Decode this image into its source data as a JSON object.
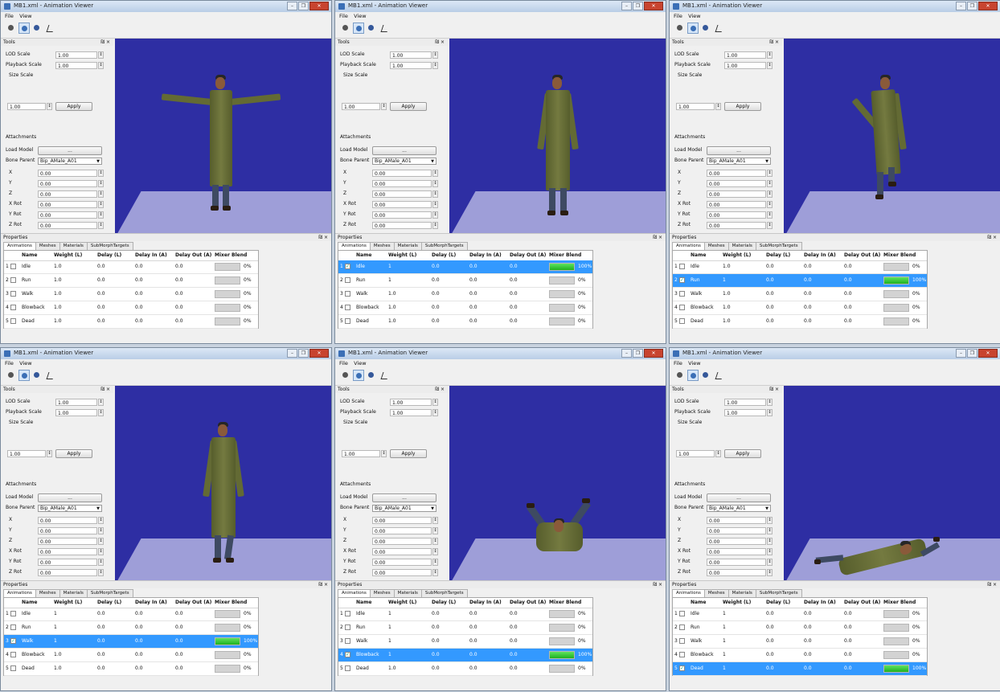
{
  "window": {
    "title": "MB1.xml - Animation Viewer",
    "menu": [
      "File",
      "View"
    ],
    "controls": [
      "–",
      "❐",
      "✕"
    ]
  },
  "tools": {
    "header": "Tools",
    "header_controls": "₪ ×",
    "lod_scale_label": "LOD Scale",
    "lod_scale_value": "1.00",
    "playback_scale_label": "Playback Scale",
    "playback_scale_value": "1.00",
    "size_scale_label": "Size Scale",
    "size_scale_value": "1.00",
    "apply_label": "Apply",
    "attachments_label": "Attachments",
    "load_model_label": "Load Model",
    "load_model_button": "...",
    "bone_parent_label": "Bone Parent",
    "bone_parent_value": "Bip_AMale_A01",
    "coords": [
      {
        "label": "X",
        "value": "0.00"
      },
      {
        "label": "Y",
        "value": "0.00"
      },
      {
        "label": "Z",
        "value": "0.00"
      },
      {
        "label": "X Rot",
        "value": "0.00"
      },
      {
        "label": "Y Rot",
        "value": "0.00"
      },
      {
        "label": "Z Rot",
        "value": "0.00"
      }
    ]
  },
  "properties": {
    "header": "Properties",
    "header_controls": "₪ ×",
    "tabs": [
      "Animations",
      "Meshes",
      "Materials",
      "SubMorphTargets"
    ],
    "columns": [
      "Name",
      "Weight (L)",
      "Delay (L)",
      "Delay In (A)",
      "Delay Out (A)",
      "Mixer Blend"
    ]
  },
  "windows": [
    {
      "pose": "tpose",
      "selected": -1,
      "rows": [
        {
          "num": "1",
          "name": "Idle",
          "weight": "1.0",
          "delay": "0.0",
          "delay_in": "0.0",
          "delay_out": "0.0",
          "blend": "0%",
          "blend_fraction": 0,
          "checked": false
        },
        {
          "num": "2",
          "name": "Run",
          "weight": "1.0",
          "delay": "0.0",
          "delay_in": "0.0",
          "delay_out": "0.0",
          "blend": "0%",
          "blend_fraction": 0,
          "checked": false
        },
        {
          "num": "3",
          "name": "Walk",
          "weight": "1.0",
          "delay": "0.0",
          "delay_in": "0.0",
          "delay_out": "0.0",
          "blend": "0%",
          "blend_fraction": 0,
          "checked": false
        },
        {
          "num": "4",
          "name": "Blowback",
          "weight": "1.0",
          "delay": "0.0",
          "delay_in": "0.0",
          "delay_out": "0.0",
          "blend": "0%",
          "blend_fraction": 0,
          "checked": false
        },
        {
          "num": "5",
          "name": "Dead",
          "weight": "1.0",
          "delay": "0.0",
          "delay_in": "0.0",
          "delay_out": "0.0",
          "blend": "0%",
          "blend_fraction": 0,
          "checked": false
        }
      ]
    },
    {
      "pose": "idle",
      "selected": 0,
      "rows": [
        {
          "num": "1",
          "name": "Idle",
          "weight": "1",
          "delay": "0.0",
          "delay_in": "0.0",
          "delay_out": "0.0",
          "blend": "100%",
          "blend_fraction": 1,
          "checked": true
        },
        {
          "num": "2",
          "name": "Run",
          "weight": "1",
          "delay": "0.0",
          "delay_in": "0.0",
          "delay_out": "0.0",
          "blend": "0%",
          "blend_fraction": 0,
          "checked": false
        },
        {
          "num": "3",
          "name": "Walk",
          "weight": "1.0",
          "delay": "0.0",
          "delay_in": "0.0",
          "delay_out": "0.0",
          "blend": "0%",
          "blend_fraction": 0,
          "checked": false
        },
        {
          "num": "4",
          "name": "Blowback",
          "weight": "1.0",
          "delay": "0.0",
          "delay_in": "0.0",
          "delay_out": "0.0",
          "blend": "0%",
          "blend_fraction": 0,
          "checked": false
        },
        {
          "num": "5",
          "name": "Dead",
          "weight": "1.0",
          "delay": "0.0",
          "delay_in": "0.0",
          "delay_out": "0.0",
          "blend": "0%",
          "blend_fraction": 0,
          "checked": false
        }
      ]
    },
    {
      "pose": "run",
      "selected": 1,
      "rows": [
        {
          "num": "1",
          "name": "Idle",
          "weight": "1.0",
          "delay": "0.0",
          "delay_in": "0.0",
          "delay_out": "0.0",
          "blend": "0%",
          "blend_fraction": 0,
          "checked": false
        },
        {
          "num": "2",
          "name": "Run",
          "weight": "1",
          "delay": "0.0",
          "delay_in": "0.0",
          "delay_out": "0.0",
          "blend": "100%",
          "blend_fraction": 1,
          "checked": true
        },
        {
          "num": "3",
          "name": "Walk",
          "weight": "1.0",
          "delay": "0.0",
          "delay_in": "0.0",
          "delay_out": "0.0",
          "blend": "0%",
          "blend_fraction": 0,
          "checked": false
        },
        {
          "num": "4",
          "name": "Blowback",
          "weight": "1.0",
          "delay": "0.0",
          "delay_in": "0.0",
          "delay_out": "0.0",
          "blend": "0%",
          "blend_fraction": 0,
          "checked": false
        },
        {
          "num": "5",
          "name": "Dead",
          "weight": "1.0",
          "delay": "0.0",
          "delay_in": "0.0",
          "delay_out": "0.0",
          "blend": "0%",
          "blend_fraction": 0,
          "checked": false
        }
      ]
    },
    {
      "pose": "walk",
      "selected": 2,
      "rows": [
        {
          "num": "1",
          "name": "Idle",
          "weight": "1",
          "delay": "0.0",
          "delay_in": "0.0",
          "delay_out": "0.0",
          "blend": "0%",
          "blend_fraction": 0,
          "checked": false
        },
        {
          "num": "2",
          "name": "Run",
          "weight": "1",
          "delay": "0.0",
          "delay_in": "0.0",
          "delay_out": "0.0",
          "blend": "0%",
          "blend_fraction": 0,
          "checked": false
        },
        {
          "num": "3",
          "name": "Walk",
          "weight": "1",
          "delay": "0.0",
          "delay_in": "0.0",
          "delay_out": "0.0",
          "blend": "100%",
          "blend_fraction": 1,
          "checked": true
        },
        {
          "num": "4",
          "name": "Blowback",
          "weight": "1.0",
          "delay": "0.0",
          "delay_in": "0.0",
          "delay_out": "0.0",
          "blend": "0%",
          "blend_fraction": 0,
          "checked": false
        },
        {
          "num": "5",
          "name": "Dead",
          "weight": "1.0",
          "delay": "0.0",
          "delay_in": "0.0",
          "delay_out": "0.0",
          "blend": "0%",
          "blend_fraction": 0,
          "checked": false
        }
      ]
    },
    {
      "pose": "blowback",
      "selected": 3,
      "rows": [
        {
          "num": "1",
          "name": "Idle",
          "weight": "1",
          "delay": "0.0",
          "delay_in": "0.0",
          "delay_out": "0.0",
          "blend": "0%",
          "blend_fraction": 0,
          "checked": false
        },
        {
          "num": "2",
          "name": "Run",
          "weight": "1",
          "delay": "0.0",
          "delay_in": "0.0",
          "delay_out": "0.0",
          "blend": "0%",
          "blend_fraction": 0,
          "checked": false
        },
        {
          "num": "3",
          "name": "Walk",
          "weight": "1",
          "delay": "0.0",
          "delay_in": "0.0",
          "delay_out": "0.0",
          "blend": "0%",
          "blend_fraction": 0,
          "checked": false
        },
        {
          "num": "4",
          "name": "Blowback",
          "weight": "1",
          "delay": "0.0",
          "delay_in": "0.0",
          "delay_out": "0.0",
          "blend": "100%",
          "blend_fraction": 1,
          "checked": true
        },
        {
          "num": "5",
          "name": "Dead",
          "weight": "1.0",
          "delay": "0.0",
          "delay_in": "0.0",
          "delay_out": "0.0",
          "blend": "0%",
          "blend_fraction": 0,
          "checked": false
        }
      ]
    },
    {
      "pose": "dead",
      "selected": 4,
      "rows": [
        {
          "num": "1",
          "name": "Idle",
          "weight": "1",
          "delay": "0.0",
          "delay_in": "0.0",
          "delay_out": "0.0",
          "blend": "0%",
          "blend_fraction": 0,
          "checked": false
        },
        {
          "num": "2",
          "name": "Run",
          "weight": "1",
          "delay": "0.0",
          "delay_in": "0.0",
          "delay_out": "0.0",
          "blend": "0%",
          "blend_fraction": 0,
          "checked": false
        },
        {
          "num": "3",
          "name": "Walk",
          "weight": "1",
          "delay": "0.0",
          "delay_in": "0.0",
          "delay_out": "0.0",
          "blend": "0%",
          "blend_fraction": 0,
          "checked": false
        },
        {
          "num": "4",
          "name": "Blowback",
          "weight": "1",
          "delay": "0.0",
          "delay_in": "0.0",
          "delay_out": "0.0",
          "blend": "0%",
          "blend_fraction": 0,
          "checked": false
        },
        {
          "num": "5",
          "name": "Dead",
          "weight": "1",
          "delay": "0.0",
          "delay_in": "0.0",
          "delay_out": "0.0",
          "blend": "100%",
          "blend_fraction": 1,
          "checked": true
        }
      ]
    }
  ],
  "colors": {
    "viewport": "#2e2ea3",
    "floor": "#9e9ed8",
    "selection": "#3399ff",
    "blend_fill": "#22b422"
  }
}
